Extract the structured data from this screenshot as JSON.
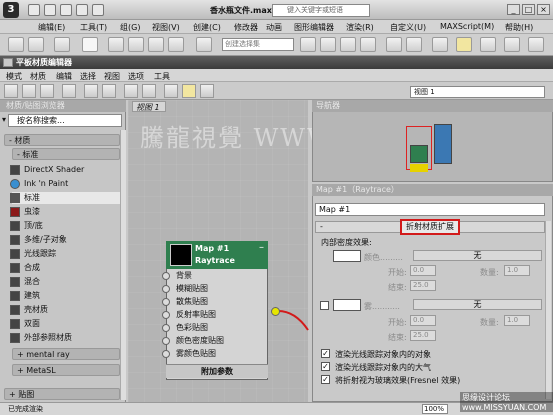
{
  "app": {
    "title": "香水瓶文件.max",
    "search_placeholder": "键入关键字或短语",
    "logo": "3"
  },
  "main_menu": [
    "编辑(E)",
    "工具(T)",
    "组(G)",
    "视图(V)",
    "创建(C)",
    "修改器",
    "动画",
    "图形编辑器",
    "渲染(R)",
    "自定义(U)",
    "MAXScript(M)",
    "帮助(H)"
  ],
  "toolbar": {
    "selection_set_placeholder": "创建选择集"
  },
  "sme": {
    "title": "平板材质编辑器",
    "menu": [
      "模式",
      "材质",
      "编辑",
      "选择",
      "视图",
      "选项",
      "工具"
    ],
    "view_dropdown": "视图 1"
  },
  "browser": {
    "title": "材质/贴图浏览器",
    "search": "按名称搜索...",
    "groups": [
      "- 材质",
      "- 标准",
      "+ mental ray",
      "+ MetaSL",
      "+ 贴图"
    ],
    "items": [
      {
        "label": "DirectX Shader",
        "color": "#444444"
      },
      {
        "label": "Ink 'n Paint",
        "color": "#3a8fd0"
      },
      {
        "label": "标准",
        "color": "#555555"
      },
      {
        "label": "虫漆",
        "color": "#8b1a1a"
      },
      {
        "label": "顶/底",
        "color": "#444444"
      },
      {
        "label": "多维/子对象",
        "color": "#444444"
      },
      {
        "label": "光线跟踪",
        "color": "#444444"
      },
      {
        "label": "合成",
        "color": "#444444"
      },
      {
        "label": "混合",
        "color": "#444444"
      },
      {
        "label": "建筑",
        "color": "#444444"
      },
      {
        "label": "壳材质",
        "color": "#444444"
      },
      {
        "label": "双面",
        "color": "#444444"
      },
      {
        "label": "外部参照材质",
        "color": "#444444"
      }
    ]
  },
  "view": {
    "tab": "视图 1",
    "watermark": "騰龍視覺 WWW.TLYVI.NET",
    "node": {
      "title1": "Map #1",
      "title2": "Raytrace",
      "slots": [
        "背景",
        "模糊贴图",
        "散焦贴图",
        "反射率贴图",
        "色彩贴图",
        "颜色密度贴图",
        "雾颜色贴图"
      ],
      "footer": "附加参数"
    }
  },
  "navigator": {
    "title": "导航器"
  },
  "props": {
    "title": "Map #1（Raytrace）",
    "map_name": "Map #1",
    "rollout": "折射材质扩展",
    "section": "内部密度效果:",
    "color_label": "颜色.........",
    "fog_label": "雾...........",
    "none": "无",
    "amount_label": "数量:",
    "start_label": "开始:",
    "end_label": "结束:",
    "vals": {
      "amount1": "1.0",
      "start1": "0.0",
      "end1": "25.0",
      "amount2": "1.0",
      "start2": "0.0",
      "end2": "25.0"
    },
    "checkboxes": [
      "渲染光线跟踪对象内的对象",
      "渲染光线跟踪对象内的大气",
      "将折射视为玻璃效果(Fresnel 效果)"
    ]
  },
  "status": {
    "text": "已完成渲染",
    "zoom": "100%",
    "footer_wm": "思缘设计论坛 www.MISSYUAN.COM"
  }
}
